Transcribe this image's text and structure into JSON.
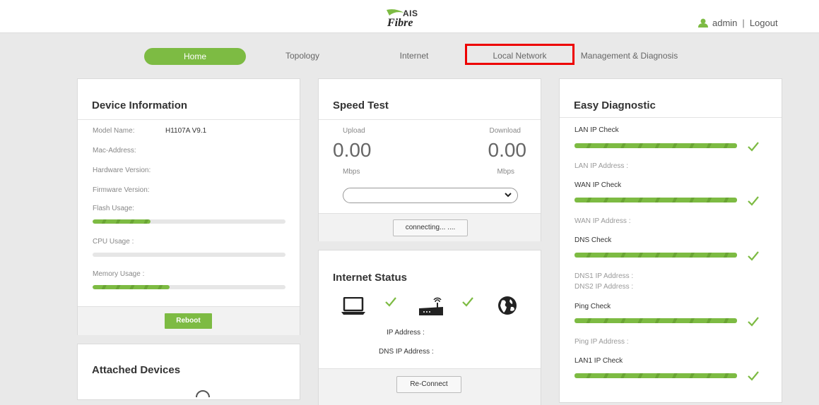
{
  "brand": {
    "top": "AIS",
    "bottom": "Fibre"
  },
  "user": {
    "name": "admin",
    "separator": "|",
    "logout": "Logout"
  },
  "nav": {
    "home": "Home",
    "topology": "Topology",
    "internet": "Internet",
    "local_network": "Local Network",
    "management": "Management & Diagnosis"
  },
  "device": {
    "title": "Device Information",
    "model_label": "Model Name:",
    "model_value": "H1107A V9.1",
    "mac_label": "Mac-Address:",
    "hw_label": "Hardware Version:",
    "fw_label": "Firmware Version:",
    "flash_label": "Flash Usage:",
    "flash_level": 0.3,
    "cpu_label": "CPU Usage :",
    "cpu_level": 0,
    "mem_label": "Memory Usage :",
    "mem_level": 0.4,
    "reboot": "Reboot"
  },
  "speed": {
    "title": "Speed Test",
    "upload_label": "Upload",
    "download_label": "Download",
    "upload_value": "0.00",
    "download_value": "0.00",
    "upload_unit": "Mbps",
    "download_unit": "Mbps",
    "select_value": "",
    "status_button": "connecting... ...."
  },
  "internet_status": {
    "title": "Internet Status",
    "ip_label": "IP Address :",
    "dns_label": "DNS IP Address :",
    "reconnect": "Re-Connect"
  },
  "attached": {
    "title": "Attached Devices"
  },
  "diagnostic": {
    "title": "Easy Diagnostic",
    "lan_check": "LAN IP Check",
    "lan_addr": "LAN IP Address :",
    "wan_check": "WAN IP Check",
    "wan_addr": "WAN IP Address :",
    "dns_check": "DNS Check",
    "dns1_addr": "DNS1 IP Address :",
    "dns2_addr": "DNS2 IP Address :",
    "ping_check": "Ping Check",
    "ping_addr": "Ping IP Address :",
    "lan1_check": "LAN1 IP Check"
  },
  "colors": {
    "accent": "#7dbb43",
    "highlight": "#ee0000",
    "background": "#e9e9e9"
  }
}
